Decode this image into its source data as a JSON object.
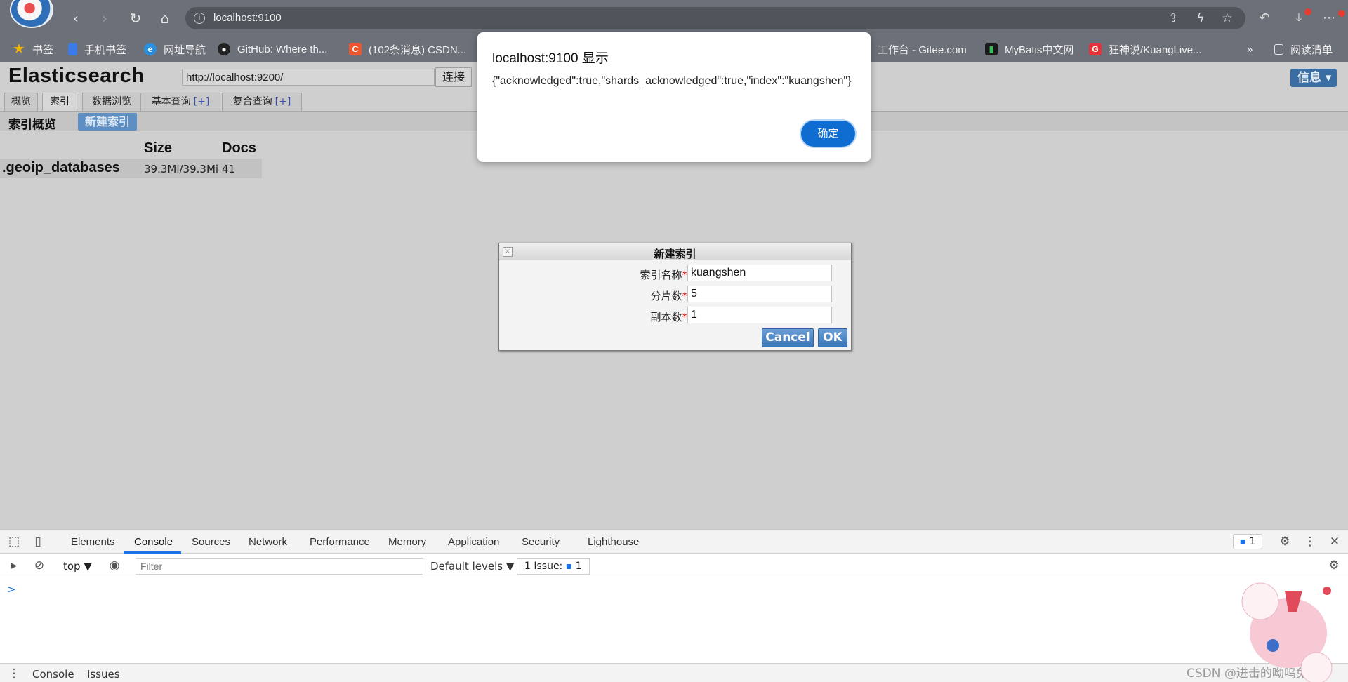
{
  "browser": {
    "url": "localhost:9100",
    "bookmarks": [
      {
        "label": "书签",
        "icon": "star-icon",
        "color": "#f5b400"
      },
      {
        "label": "手机书签",
        "icon": "phone-bookmark-icon",
        "color": "#3b7be8"
      },
      {
        "label": "网址导航",
        "icon": "edge-icon",
        "color": "#2b8fe0"
      },
      {
        "label": "GitHub: Where th...",
        "icon": "github-icon",
        "color": "#222222"
      },
      {
        "label": "(102条消息) CSDN...",
        "icon": "csdn-icon",
        "color": "#f0562e"
      },
      {
        "label": "工作台 - Gitee.com",
        "icon": "gitee-icon",
        "color": "#6c7078"
      },
      {
        "label": "MyBatis中文网",
        "icon": "mybatis-icon",
        "color": "#1a1a1a"
      },
      {
        "label": "狂神说/KuangLive...",
        "icon": "kuang-icon",
        "color": "#e2343a"
      },
      {
        "label": "阅读清单",
        "icon": "reading-list-icon",
        "color": "#6c7078"
      }
    ],
    "overflow": "»"
  },
  "app": {
    "title": "Elasticsearch",
    "cluster_url": "http://localhost:9200/",
    "connect_label": "连接",
    "info_label": "信息 ▾",
    "tabs": [
      {
        "label": "概览",
        "plus": ""
      },
      {
        "label": "索引",
        "plus": ""
      },
      {
        "label": "数据浏览",
        "plus": ""
      },
      {
        "label": "基本查询",
        "plus": "[+]"
      },
      {
        "label": "复合查询",
        "plus": "[+]"
      }
    ],
    "subbar_title": "索引概览",
    "new_index_label": "新建索引",
    "table": {
      "headers": [
        "Size",
        "Docs"
      ],
      "rows": [
        {
          "name": ".geoip_databases",
          "size": "39.3Mi/39.3Mi",
          "docs": "41"
        }
      ]
    }
  },
  "dialog": {
    "title": "新建索引",
    "fields": [
      {
        "label": "索引名称",
        "value": "kuangshen"
      },
      {
        "label": "分片数",
        "value": "5"
      },
      {
        "label": "副本数",
        "value": "1"
      }
    ],
    "required_mark": "*",
    "cancel_label": "Cancel",
    "ok_label": "OK"
  },
  "alert": {
    "title": "localhost:9100 显示",
    "message": "{\"acknowledged\":true,\"shards_acknowledged\":true,\"index\":\"kuangshen\"}",
    "ok_label": "确定"
  },
  "devtools": {
    "tabs": [
      "Elements",
      "Console",
      "Sources",
      "Network",
      "Performance",
      "Memory",
      "Application",
      "Security",
      "Lighthouse"
    ],
    "active_tab": "Console",
    "badge": "1",
    "context": "top ▼",
    "filter_placeholder": "Filter",
    "levels": "Default levels ▼",
    "issues": "1 Issue:",
    "issues_count": "1",
    "prompt": ">",
    "drawer_tabs": [
      "Console",
      "Issues"
    ]
  },
  "watermark": "CSDN @进击的呦呜兔兔"
}
